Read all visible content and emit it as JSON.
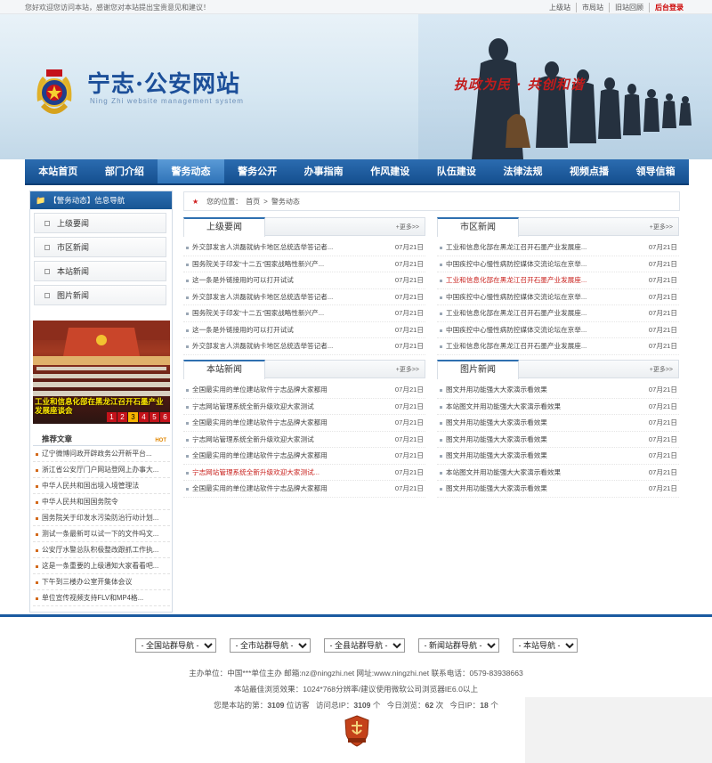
{
  "topbar": {
    "welcome": "您好欢迎您访问本站，感谢您对本站提出宝贵意见和建议！",
    "links": [
      "上级站",
      "市局站",
      "旧站回顾"
    ],
    "admin": "后台登录"
  },
  "header": {
    "site_name": "宁志·公安网站",
    "site_sub": "Ning Zhi website management system",
    "slogan": "执政为民 · 共创和谐"
  },
  "nav": [
    "本站首页",
    "部门介绍",
    "警务动态",
    "警务公开",
    "办事指南",
    "作风建设",
    "队伍建设",
    "法律法规",
    "视频点播",
    "领导信箱"
  ],
  "nav_active": 2,
  "sidebar": {
    "title": "【警务动态】信息导航",
    "items": [
      "上级要闻",
      "市区新闻",
      "本站新闻",
      "图片新闻"
    ],
    "slide_caption": "工业和信息化部在黑龙江召开石墨产业发展座谈会",
    "slide_numbers": [
      "1",
      "2",
      "3",
      "4",
      "5",
      "6"
    ],
    "slide_active": 2
  },
  "recommend": {
    "title": "推荐文章",
    "hot": "HOT",
    "items": [
      "辽宁微博问政开辟政务公开新平台...",
      "浙江省公安厅门户网站登网上办事大...",
      "中华人民共和国出境入境管理法",
      "中华人民共和国国务院令",
      "国务院关于印发水污染防治行动计划...",
      "测试一条最新可以试一下的文件吗文...",
      "公安厅水警总队积极整改跟抓工作执...",
      "这是一条重要的上级通知大家看看吧...",
      "下午到三楼办公室开集体会议",
      "单位宣传视频支持FLV和MP4格..."
    ]
  },
  "breadcrumb": {
    "label": "您的位置：",
    "home": "首页",
    "sep": ">",
    "current": "警务动态"
  },
  "more_label": "+更多>>",
  "panels": {
    "upper": {
      "title": "上级要闻",
      "rows": [
        {
          "title": "外交部发言人洪磊就纳卡地区总统选举答记者...",
          "date": "07月21日",
          "red": false
        },
        {
          "title": "国务院关于印发“十二五”国家战略性新兴产...",
          "date": "07月21日",
          "red": false
        },
        {
          "title": "这一条是外链接用的可以打开试试",
          "date": "07月21日",
          "red": false
        },
        {
          "title": "外交部发言人洪磊就纳卡地区总统选举答记者...",
          "date": "07月21日",
          "red": false
        },
        {
          "title": "国务院关于印发“十二五”国家战略性新兴产...",
          "date": "07月21日",
          "red": false
        },
        {
          "title": "这一条是外链接用的可以打开试试",
          "date": "07月21日",
          "red": false
        },
        {
          "title": "外交部发言人洪磊就纳卡地区总统选举答记者...",
          "date": "07月21日",
          "red": false
        }
      ]
    },
    "city": {
      "title": "市区新闻",
      "rows": [
        {
          "title": "工业和信息化部在黑龙江召开石墨产业发展座...",
          "date": "07月21日",
          "red": false
        },
        {
          "title": "中国疾控中心慢性病防控媒体交流论坛在京举...",
          "date": "07月21日",
          "red": false
        },
        {
          "title": "工业和信息化部在黑龙江召开石墨产业发展座...",
          "date": "07月21日",
          "red": true
        },
        {
          "title": "中国疾控中心慢性病防控媒体交流论坛在京举...",
          "date": "07月21日",
          "red": false
        },
        {
          "title": "工业和信息化部在黑龙江召开石墨产业发展座...",
          "date": "07月21日",
          "red": false
        },
        {
          "title": "中国疾控中心慢性病防控媒体交流论坛在京举...",
          "date": "07月21日",
          "red": false
        },
        {
          "title": "工业和信息化部在黑龙江召开石墨产业发展座...",
          "date": "07月21日",
          "red": false
        }
      ]
    },
    "local": {
      "title": "本站新闻",
      "rows": [
        {
          "title": "全国最实用的单位建站软件宁志品牌大家都用",
          "date": "07月21日",
          "red": false
        },
        {
          "title": "宁志网站管理系统全新升级欢迎大家测试",
          "date": "07月21日",
          "red": false
        },
        {
          "title": "全国最实用的单位建站软件宁志品牌大家都用",
          "date": "07月21日",
          "red": false
        },
        {
          "title": "宁志网站管理系统全新升级欢迎大家测试",
          "date": "07月21日",
          "red": false
        },
        {
          "title": "全国最实用的单位建站软件宁志品牌大家都用",
          "date": "07月21日",
          "red": false
        },
        {
          "title": "宁志网站管理系统全新升级欢迎大家测试...",
          "date": "07月21日",
          "red": true
        },
        {
          "title": "全国最实用的单位建站软件宁志品牌大家都用",
          "date": "07月21日",
          "red": false
        }
      ]
    },
    "photo": {
      "title": "图片新闻",
      "rows": [
        {
          "title": "图文并用功能强大大家演示看效果",
          "date": "07月21日",
          "red": false
        },
        {
          "title": "本站图文并用功能强大大家演示看效果",
          "date": "07月21日",
          "red": false
        },
        {
          "title": "图文并用功能强大大家演示看效果",
          "date": "07月21日",
          "red": false
        },
        {
          "title": "图文并用功能强大大家演示看效果",
          "date": "07月21日",
          "red": false
        },
        {
          "title": "图文并用功能强大大家演示看效果",
          "date": "07月21日",
          "red": false
        },
        {
          "title": "本站图文并用功能强大大家演示看效果",
          "date": "07月21日",
          "red": false
        },
        {
          "title": "图文并用功能强大大家演示看效果",
          "date": "07月21日",
          "red": false
        }
      ]
    }
  },
  "footer": {
    "selects": [
      "- 全国站群导航 -",
      "- 全市站群导航 -",
      "- 全县站群导航 -",
      "- 新闻站群导航 -",
      "- 本站导航 -"
    ],
    "line1": "主办单位：中国***单位主办  邮箱:nz@ningzhi.net  网址:www.ningzhi.net  联系电话：0579-83938663",
    "line2": "本站最佳浏览效果：1024*768分辨率/建议使用微软公司浏览器IE6.0以上",
    "stats": {
      "visit_label": "您是本站的第：",
      "visit_count": "3109",
      "visit_unit": "位访客",
      "ip_label": "访问总IP：",
      "ip_count": "3109",
      "ip_unit": "个",
      "today_view_label": "今日浏览：",
      "today_view": "62",
      "today_view_unit": "次",
      "today_ip_label": "今日IP：",
      "today_ip": "18",
      "today_ip_unit": "个"
    }
  },
  "colors": {
    "brand_blue": "#1c4f99",
    "nav_blue": "#154f8f",
    "accent_red": "#c8201c"
  }
}
